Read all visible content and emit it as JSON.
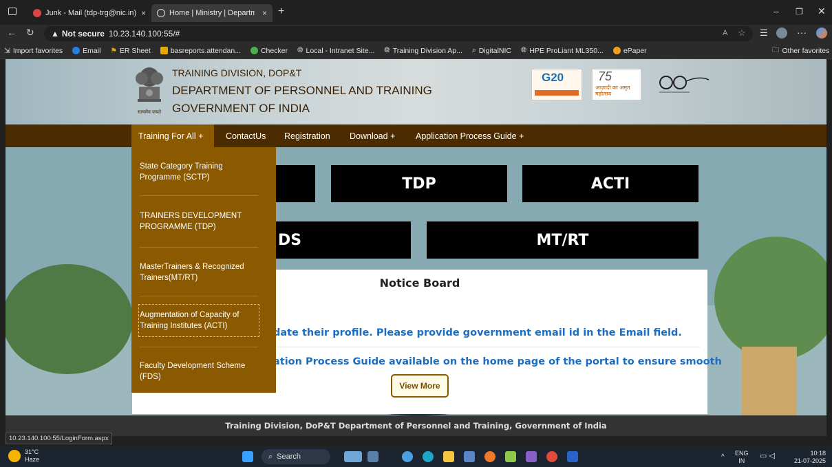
{
  "browser": {
    "tabs": [
      {
        "title": "Junk - Mail (tdp-trg@nic.in)"
      },
      {
        "title": "Home | Ministry | Department | G"
      }
    ],
    "new_tab_label": "+",
    "address": {
      "security_label": "Not secure",
      "url": "10.23.140.100:55/#"
    },
    "bookmarks": [
      {
        "label": "Import favorites",
        "icon": "import-icon"
      },
      {
        "label": "Email",
        "icon": "email-icon"
      },
      {
        "label": "ER Sheet",
        "icon": "sheet-icon"
      },
      {
        "label": "basreports.attendan...",
        "icon": "report-icon"
      },
      {
        "label": "Checker",
        "icon": "checker-icon"
      },
      {
        "label": "Local - Intranet Site...",
        "icon": "globe-icon"
      },
      {
        "label": "Training Division Ap...",
        "icon": "globe-icon"
      },
      {
        "label": "DigitalNIC",
        "icon": "search-icon"
      },
      {
        "label": "HPE ProLiant ML350...",
        "icon": "globe-icon"
      },
      {
        "label": "ePaper",
        "icon": "paper-icon"
      }
    ],
    "other_favorites": "Other favorites"
  },
  "header": {
    "line1": "TRAINING DIVISION, DOP&T",
    "line2": "DEPARTMENT OF PERSONNEL AND TRAINING",
    "line3": "GOVERNMENT OF INDIA",
    "emblem_caption": "सत्यमेव जयते",
    "logo_g20": "G20",
    "logo_azadi": "आज़ादी का अमृत महोत्सव",
    "logo_azadi_num": "75"
  },
  "nav": {
    "items": [
      {
        "label": "Training For All +"
      },
      {
        "label": "ContactUs"
      },
      {
        "label": "Registration"
      },
      {
        "label": "Download +"
      },
      {
        "label": "Application Process Guide +"
      }
    ]
  },
  "dropdown": {
    "items": [
      {
        "label": "State Category Training Programme (SCTP)"
      },
      {
        "label": "TRAINERS DEVELOPMENT PROGRAMME (TDP)"
      },
      {
        "label": "MasterTrainers & Recognized Trainers(MT/RT)"
      },
      {
        "label": "Augmentation of Capacity of Training Institutes (ACTI)"
      },
      {
        "label": "Faculty Development Scheme (FDS)"
      }
    ]
  },
  "tiles": {
    "tdp": "TDP",
    "acti": "ACTI",
    "fds_partial": "DS",
    "mtrt": "MT/RT"
  },
  "notice": {
    "title": "Notice Board",
    "line1": "date their profile. Please provide government email id in the Email field.",
    "line2": "ation Process Guide available on the home page of the portal to ensure smooth",
    "view_more": "View More"
  },
  "footer": {
    "text": "Training Division, DoP&T Department of Personnel and Training, Government of India"
  },
  "status_url": "10.23.140.100:55/LoginForm.aspx",
  "taskbar": {
    "weather_temp": "31°C",
    "weather_desc": "Haze",
    "search_label": "Search",
    "lang_line1": "ENG",
    "lang_line2": "IN",
    "time": "10:18",
    "date": "21-07-2025"
  },
  "colors": {
    "nav_bg": "#4b2c00",
    "dropdown_bg": "#8b5a00",
    "notice_link": "#1a6fc4"
  }
}
